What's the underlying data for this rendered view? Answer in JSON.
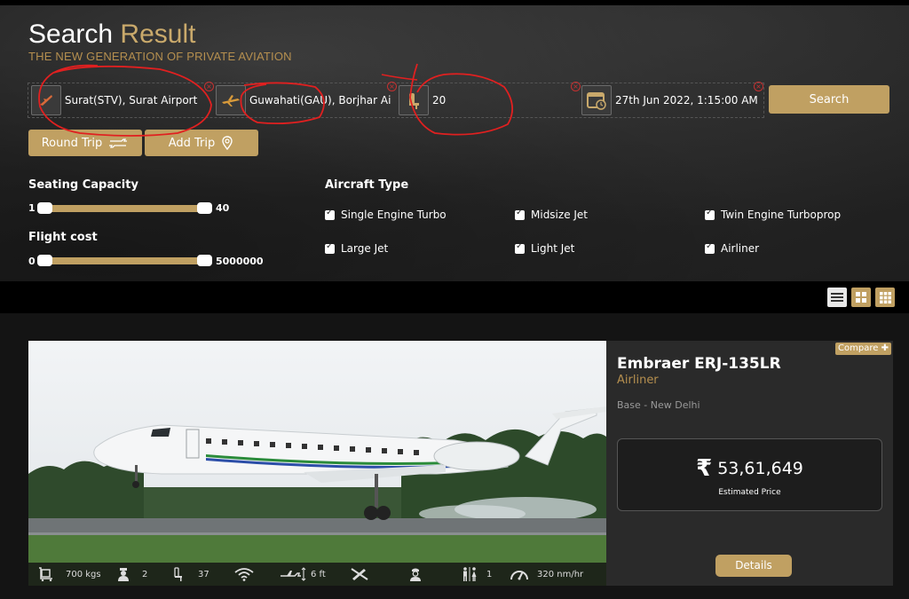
{
  "header": {
    "title_word1": "Search",
    "title_word2": "Result",
    "subtitle": "THE NEW GENERATION OF PRIVATE AVIATION"
  },
  "search": {
    "from": "Surat(STV), Surat Airport",
    "to": "Guwahati(GAU), Borjhar Airport",
    "passengers": "20",
    "date": "27th Jun 2022, 1:15:00 AM",
    "search_label": "Search",
    "clear_symbol": "×"
  },
  "trip_buttons": {
    "round_trip": "Round Trip",
    "add_trip": "Add Trip"
  },
  "filters": {
    "seating": {
      "heading": "Seating Capacity",
      "min": "1",
      "max": "40"
    },
    "cost": {
      "heading": "Flight cost",
      "min": "0",
      "max": "5000000"
    },
    "aircraft_heading": "Aircraft Type",
    "aircraft_types": [
      {
        "label": "Single Engine Turbo",
        "checked": true
      },
      {
        "label": "Midsize Jet",
        "checked": true
      },
      {
        "label": "Twin Engine Turboprop",
        "checked": true
      },
      {
        "label": "Large Jet",
        "checked": true
      },
      {
        "label": "Light Jet",
        "checked": true
      },
      {
        "label": "Airliner",
        "checked": true
      }
    ]
  },
  "view_modes": [
    "list-view-icon",
    "grid-view-icon",
    "large-grid-view-icon"
  ],
  "result": {
    "compare_label": "Compare",
    "model": "Embraer ERJ-135LR",
    "category": "Airliner",
    "base": "Base - New Delhi",
    "currency_symbol": "₹",
    "price": "53,61,649",
    "price_caption": "Estimated Price",
    "details_label": "Details",
    "specs": {
      "baggage": "700 kgs",
      "crew": "2",
      "seats": "37",
      "headroom": "6 ft",
      "lavatory": "1",
      "speed": "320 nm/hr"
    }
  },
  "colors": {
    "accent": "#c0a062",
    "annotation": "#e02020"
  }
}
